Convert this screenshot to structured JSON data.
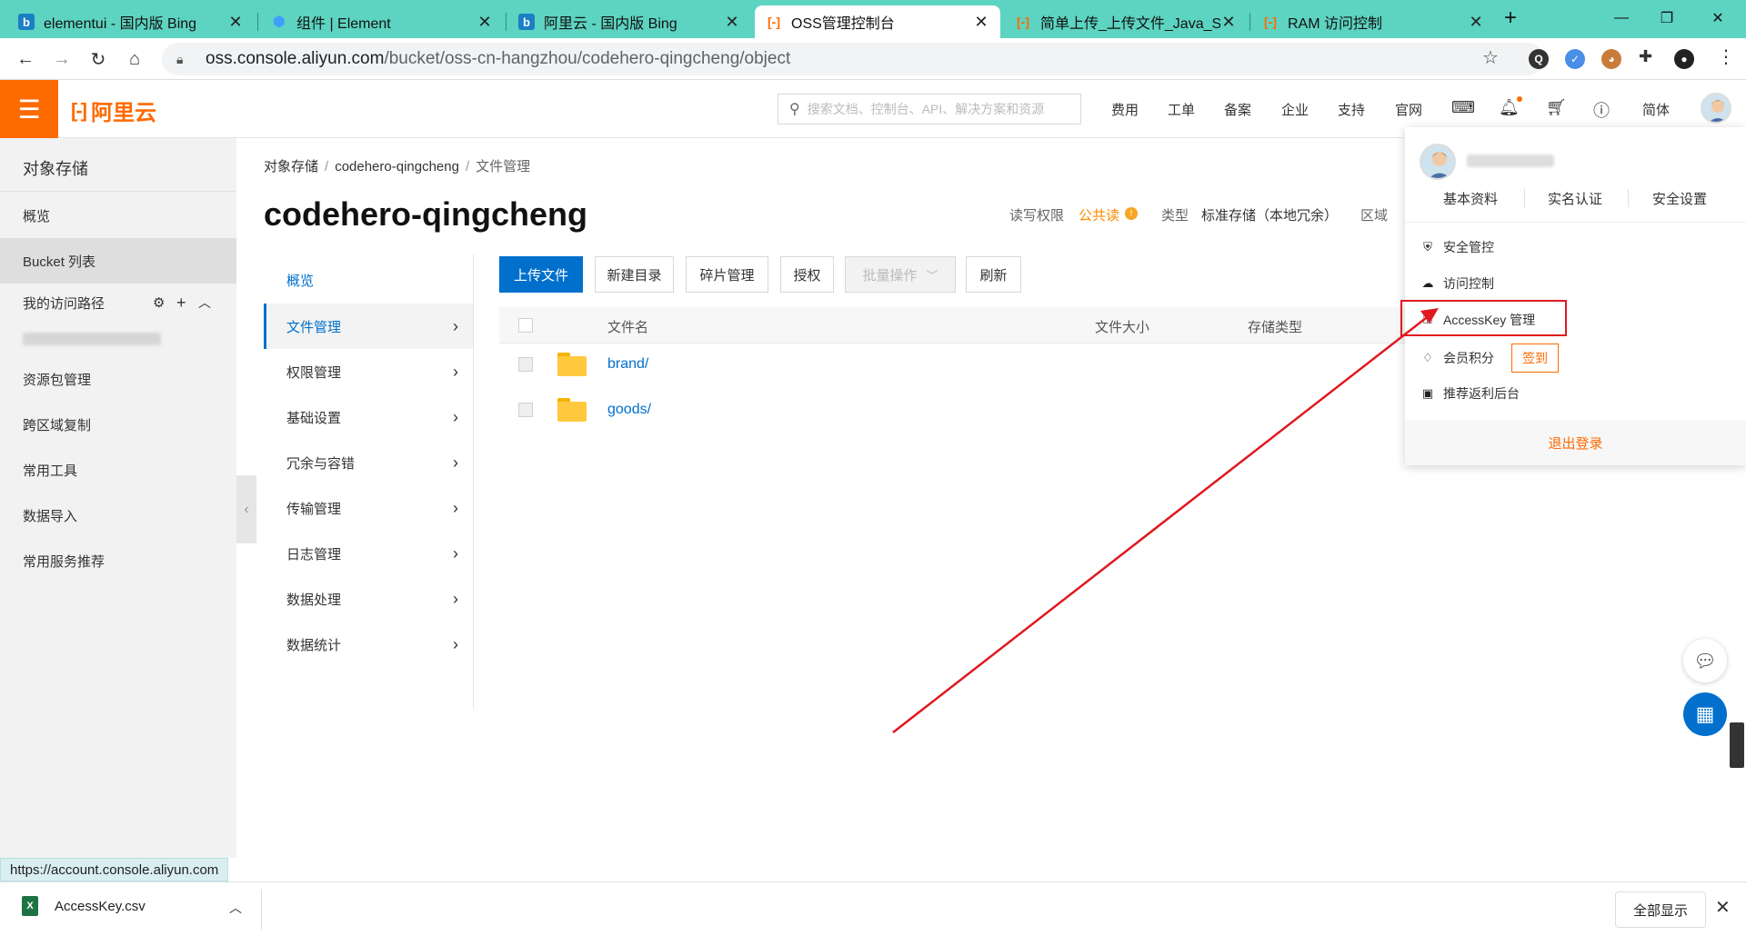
{
  "browser": {
    "tabs": [
      {
        "title": "elementui - 国内版 Bing",
        "icon": "bing"
      },
      {
        "title": "组件 | Element",
        "icon": "element"
      },
      {
        "title": "阿里云 - 国内版 Bing",
        "icon": "bing"
      },
      {
        "title": "OSS管理控制台",
        "icon": "aliyun"
      },
      {
        "title": "简单上传_上传文件_Java_SD",
        "icon": "aliyun"
      },
      {
        "title": "RAM 访问控制",
        "icon": "aliyun"
      }
    ],
    "url_host": "oss.console.aliyun.com",
    "url_path": "/bucket/oss-cn-hangzhou/codehero-qingcheng/object"
  },
  "header": {
    "logo_text": "阿里云",
    "search_placeholder": "搜索文档、控制台、API、解决方案和资源",
    "nav": [
      "费用",
      "工单",
      "备案",
      "企业",
      "支持",
      "官网"
    ],
    "lang": "简体"
  },
  "sidebar": {
    "title": "对象存储",
    "items": [
      "概览",
      "Bucket 列表",
      "我的访问路径",
      "资源包管理",
      "跨区域复制",
      "常用工具",
      "数据导入",
      "常用服务推荐"
    ]
  },
  "breadcrumb": [
    "对象存储",
    "codehero-qingcheng",
    "文件管理"
  ],
  "bucket": {
    "name": "codehero-qingcheng",
    "acl_label": "读写权限",
    "acl_value": "公共读",
    "type_label": "类型",
    "type_value": "标准存储（本地冗余）",
    "region_label": "区域"
  },
  "subnav": [
    "概览",
    "文件管理",
    "权限管理",
    "基础设置",
    "冗余与容错",
    "传输管理",
    "日志管理",
    "数据处理",
    "数据统计"
  ],
  "toolbar": {
    "upload": "上传文件",
    "new_dir": "新建目录",
    "fragments": "碎片管理",
    "authorize": "授权",
    "batch": "批量操作",
    "refresh": "刷新"
  },
  "table": {
    "columns": [
      "文件名",
      "文件大小",
      "存储类型"
    ],
    "rows": [
      {
        "name": "brand/"
      },
      {
        "name": "goods/"
      }
    ]
  },
  "user_menu": {
    "tabs": [
      "基本资料",
      "实名认证",
      "安全设置"
    ],
    "items": [
      "安全管控",
      "访问控制",
      "AccessKey 管理",
      "会员积分",
      "推荐返利后台"
    ],
    "signin": "签到",
    "logout": "退出登录"
  },
  "status_url": "https://account.console.aliyun.com",
  "downloads": {
    "file": "AccessKey.csv",
    "show_all": "全部显示"
  },
  "colors": {
    "brand_orange": "#ff6a00",
    "primary_blue": "#0070cc",
    "tabbar": "#5dd3c1",
    "annotation_red": "#e0191f"
  }
}
